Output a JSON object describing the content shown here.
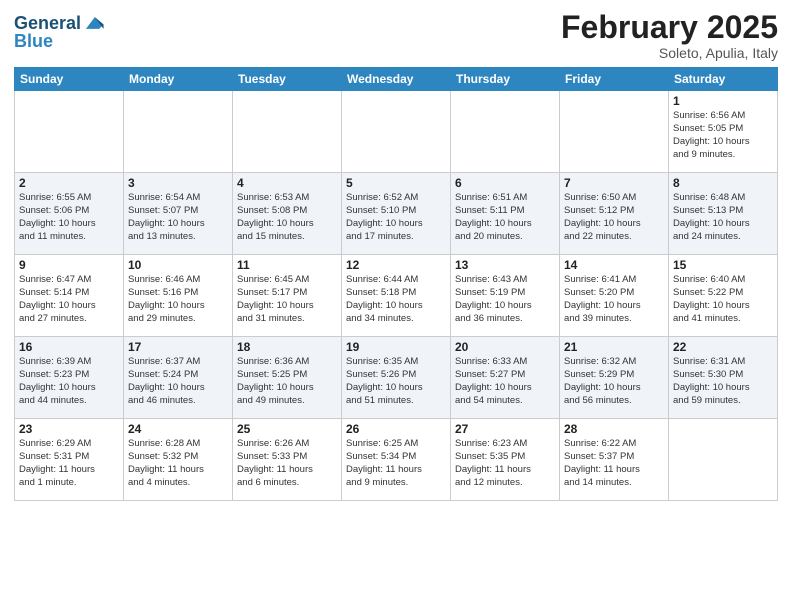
{
  "logo": {
    "line1": "General",
    "line2": "Blue"
  },
  "title": "February 2025",
  "subtitle": "Soleto, Apulia, Italy",
  "days_of_week": [
    "Sunday",
    "Monday",
    "Tuesday",
    "Wednesday",
    "Thursday",
    "Friday",
    "Saturday"
  ],
  "weeks": [
    [
      {
        "day": "",
        "info": ""
      },
      {
        "day": "",
        "info": ""
      },
      {
        "day": "",
        "info": ""
      },
      {
        "day": "",
        "info": ""
      },
      {
        "day": "",
        "info": ""
      },
      {
        "day": "",
        "info": ""
      },
      {
        "day": "1",
        "info": "Sunrise: 6:56 AM\nSunset: 5:05 PM\nDaylight: 10 hours\nand 9 minutes."
      }
    ],
    [
      {
        "day": "2",
        "info": "Sunrise: 6:55 AM\nSunset: 5:06 PM\nDaylight: 10 hours\nand 11 minutes."
      },
      {
        "day": "3",
        "info": "Sunrise: 6:54 AM\nSunset: 5:07 PM\nDaylight: 10 hours\nand 13 minutes."
      },
      {
        "day": "4",
        "info": "Sunrise: 6:53 AM\nSunset: 5:08 PM\nDaylight: 10 hours\nand 15 minutes."
      },
      {
        "day": "5",
        "info": "Sunrise: 6:52 AM\nSunset: 5:10 PM\nDaylight: 10 hours\nand 17 minutes."
      },
      {
        "day": "6",
        "info": "Sunrise: 6:51 AM\nSunset: 5:11 PM\nDaylight: 10 hours\nand 20 minutes."
      },
      {
        "day": "7",
        "info": "Sunrise: 6:50 AM\nSunset: 5:12 PM\nDaylight: 10 hours\nand 22 minutes."
      },
      {
        "day": "8",
        "info": "Sunrise: 6:48 AM\nSunset: 5:13 PM\nDaylight: 10 hours\nand 24 minutes."
      }
    ],
    [
      {
        "day": "9",
        "info": "Sunrise: 6:47 AM\nSunset: 5:14 PM\nDaylight: 10 hours\nand 27 minutes."
      },
      {
        "day": "10",
        "info": "Sunrise: 6:46 AM\nSunset: 5:16 PM\nDaylight: 10 hours\nand 29 minutes."
      },
      {
        "day": "11",
        "info": "Sunrise: 6:45 AM\nSunset: 5:17 PM\nDaylight: 10 hours\nand 31 minutes."
      },
      {
        "day": "12",
        "info": "Sunrise: 6:44 AM\nSunset: 5:18 PM\nDaylight: 10 hours\nand 34 minutes."
      },
      {
        "day": "13",
        "info": "Sunrise: 6:43 AM\nSunset: 5:19 PM\nDaylight: 10 hours\nand 36 minutes."
      },
      {
        "day": "14",
        "info": "Sunrise: 6:41 AM\nSunset: 5:20 PM\nDaylight: 10 hours\nand 39 minutes."
      },
      {
        "day": "15",
        "info": "Sunrise: 6:40 AM\nSunset: 5:22 PM\nDaylight: 10 hours\nand 41 minutes."
      }
    ],
    [
      {
        "day": "16",
        "info": "Sunrise: 6:39 AM\nSunset: 5:23 PM\nDaylight: 10 hours\nand 44 minutes."
      },
      {
        "day": "17",
        "info": "Sunrise: 6:37 AM\nSunset: 5:24 PM\nDaylight: 10 hours\nand 46 minutes."
      },
      {
        "day": "18",
        "info": "Sunrise: 6:36 AM\nSunset: 5:25 PM\nDaylight: 10 hours\nand 49 minutes."
      },
      {
        "day": "19",
        "info": "Sunrise: 6:35 AM\nSunset: 5:26 PM\nDaylight: 10 hours\nand 51 minutes."
      },
      {
        "day": "20",
        "info": "Sunrise: 6:33 AM\nSunset: 5:27 PM\nDaylight: 10 hours\nand 54 minutes."
      },
      {
        "day": "21",
        "info": "Sunrise: 6:32 AM\nSunset: 5:29 PM\nDaylight: 10 hours\nand 56 minutes."
      },
      {
        "day": "22",
        "info": "Sunrise: 6:31 AM\nSunset: 5:30 PM\nDaylight: 10 hours\nand 59 minutes."
      }
    ],
    [
      {
        "day": "23",
        "info": "Sunrise: 6:29 AM\nSunset: 5:31 PM\nDaylight: 11 hours\nand 1 minute."
      },
      {
        "day": "24",
        "info": "Sunrise: 6:28 AM\nSunset: 5:32 PM\nDaylight: 11 hours\nand 4 minutes."
      },
      {
        "day": "25",
        "info": "Sunrise: 6:26 AM\nSunset: 5:33 PM\nDaylight: 11 hours\nand 6 minutes."
      },
      {
        "day": "26",
        "info": "Sunrise: 6:25 AM\nSunset: 5:34 PM\nDaylight: 11 hours\nand 9 minutes."
      },
      {
        "day": "27",
        "info": "Sunrise: 6:23 AM\nSunset: 5:35 PM\nDaylight: 11 hours\nand 12 minutes."
      },
      {
        "day": "28",
        "info": "Sunrise: 6:22 AM\nSunset: 5:37 PM\nDaylight: 11 hours\nand 14 minutes."
      },
      {
        "day": "",
        "info": ""
      }
    ]
  ]
}
